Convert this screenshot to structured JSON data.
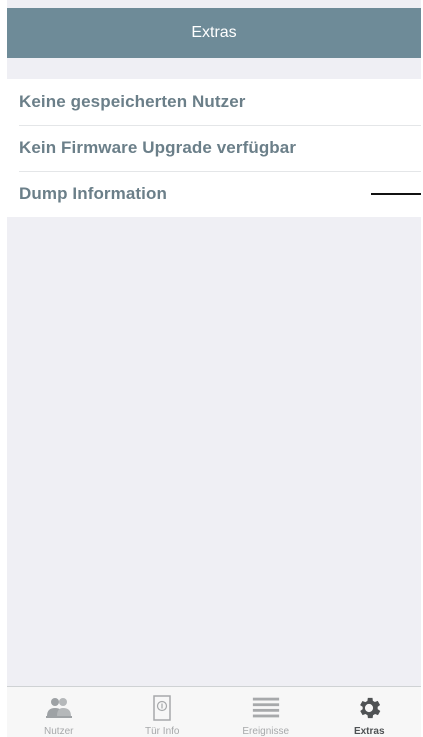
{
  "header": {
    "title": "Extras"
  },
  "rows": [
    {
      "label": "Keine gespeicherten Nutzer"
    },
    {
      "label": "Kein Firmware Upgrade verfügbar"
    },
    {
      "label": "Dump Information"
    }
  ],
  "tabbar": {
    "tabs": [
      {
        "label": "Nutzer",
        "icon": "users-icon",
        "active": false
      },
      {
        "label": "Tür Info",
        "icon": "door-info-icon",
        "active": false
      },
      {
        "label": "Ereignisse",
        "icon": "list-icon",
        "active": false
      },
      {
        "label": "Extras",
        "icon": "gear-icon",
        "active": true
      }
    ]
  },
  "colors": {
    "navbar": "#6e8b98",
    "row_text": "#6b7f89",
    "background": "#efeff4",
    "tab_inactive": "#a7a9ab",
    "tab_active": "#4f5254"
  }
}
